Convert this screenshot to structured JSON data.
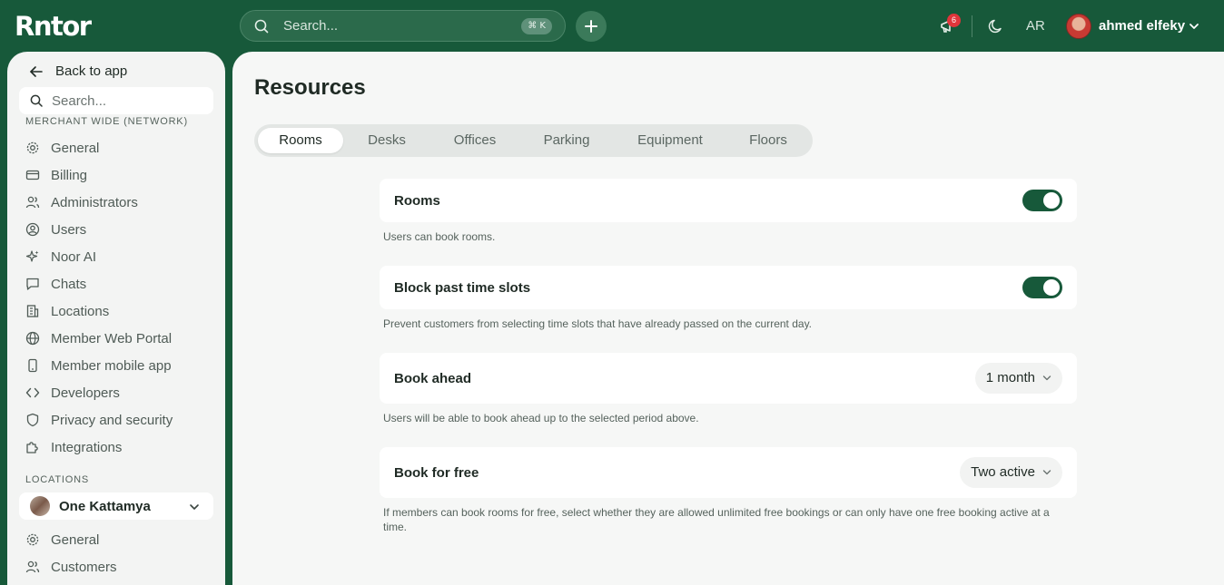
{
  "topbar": {
    "logo": "Rntor",
    "search_placeholder": "Search...",
    "shortcut": "⌘ K",
    "notifications_count": "6",
    "language": "AR",
    "user_name": "ahmed elfeky"
  },
  "sidebar": {
    "back_label": "Back to app",
    "search_placeholder": "Search...",
    "network_section": "MERCHANT WIDE (NETWORK)",
    "network_items": [
      {
        "label": "General",
        "icon": "gear-icon"
      },
      {
        "label": "Billing",
        "icon": "card-icon"
      },
      {
        "label": "Administrators",
        "icon": "users-icon"
      },
      {
        "label": "Users",
        "icon": "user-circle-icon"
      },
      {
        "label": "Noor AI",
        "icon": "sparkle-icon"
      },
      {
        "label": "Chats",
        "icon": "chat-icon"
      },
      {
        "label": "Locations",
        "icon": "building-icon"
      },
      {
        "label": "Member Web Portal",
        "icon": "globe-icon"
      },
      {
        "label": "Member mobile app",
        "icon": "phone-icon"
      },
      {
        "label": "Developers",
        "icon": "code-icon"
      },
      {
        "label": "Privacy and security",
        "icon": "shield-icon"
      },
      {
        "label": "Integrations",
        "icon": "puzzle-icon"
      }
    ],
    "locations_section": "LOCATIONS",
    "selected_location": "One Kattamya",
    "location_items": [
      {
        "label": "General",
        "icon": "gear-icon"
      },
      {
        "label": "Customers",
        "icon": "users-icon"
      }
    ]
  },
  "main": {
    "title": "Resources",
    "tabs": [
      "Rooms",
      "Desks",
      "Offices",
      "Parking",
      "Equipment",
      "Floors"
    ],
    "active_tab": "Rooms",
    "settings": {
      "rooms": {
        "label": "Rooms",
        "enabled": true,
        "helper": "Users can book rooms."
      },
      "block_past": {
        "label": "Block past time slots",
        "enabled": true,
        "helper": "Prevent customers from selecting time slots that have already passed on the current day."
      },
      "book_ahead": {
        "label": "Book ahead",
        "value": "1 month",
        "helper": "Users will be able to book ahead up to the selected period above."
      },
      "book_free": {
        "label": "Book for free",
        "value": "Two active",
        "helper": "If members can book rooms for free, select whether they are allowed unlimited free bookings or can only have one free booking active at a time."
      }
    }
  },
  "colors": {
    "brand": "#17593a",
    "badge": "#e0353b",
    "background": "#f6f7f6"
  }
}
